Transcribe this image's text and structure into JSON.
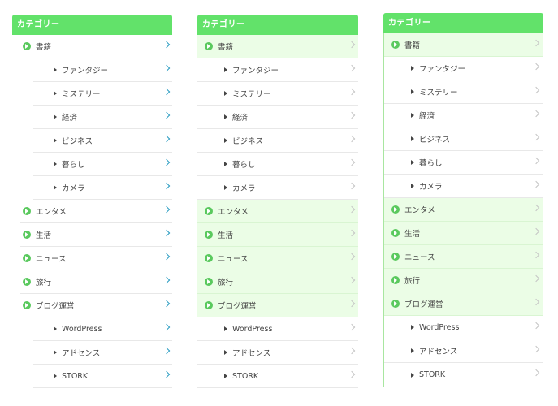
{
  "widget_title": "カテゴリー",
  "items": [
    {
      "label": "書籍",
      "level": "parent"
    },
    {
      "label": "ファンタジー",
      "level": "child"
    },
    {
      "label": "ミステリー",
      "level": "child"
    },
    {
      "label": "経済",
      "level": "child"
    },
    {
      "label": "ビジネス",
      "level": "child"
    },
    {
      "label": "暮らし",
      "level": "child"
    },
    {
      "label": "カメラ",
      "level": "child"
    },
    {
      "label": "エンタメ",
      "level": "parent"
    },
    {
      "label": "生活",
      "level": "parent"
    },
    {
      "label": "ニュース",
      "level": "parent"
    },
    {
      "label": "旅行",
      "level": "parent"
    },
    {
      "label": "ブログ運営",
      "level": "parent"
    },
    {
      "label": "WordPress",
      "level": "child"
    },
    {
      "label": "アドセンス",
      "level": "child"
    },
    {
      "label": "STORK",
      "level": "child"
    }
  ],
  "colors": {
    "header": "#62e26a",
    "parent_bg": "#ebfde6",
    "icon": "#5ac95e",
    "chevron_blue": "#2b9cc2",
    "chevron_gray": "#c4c4c4"
  }
}
